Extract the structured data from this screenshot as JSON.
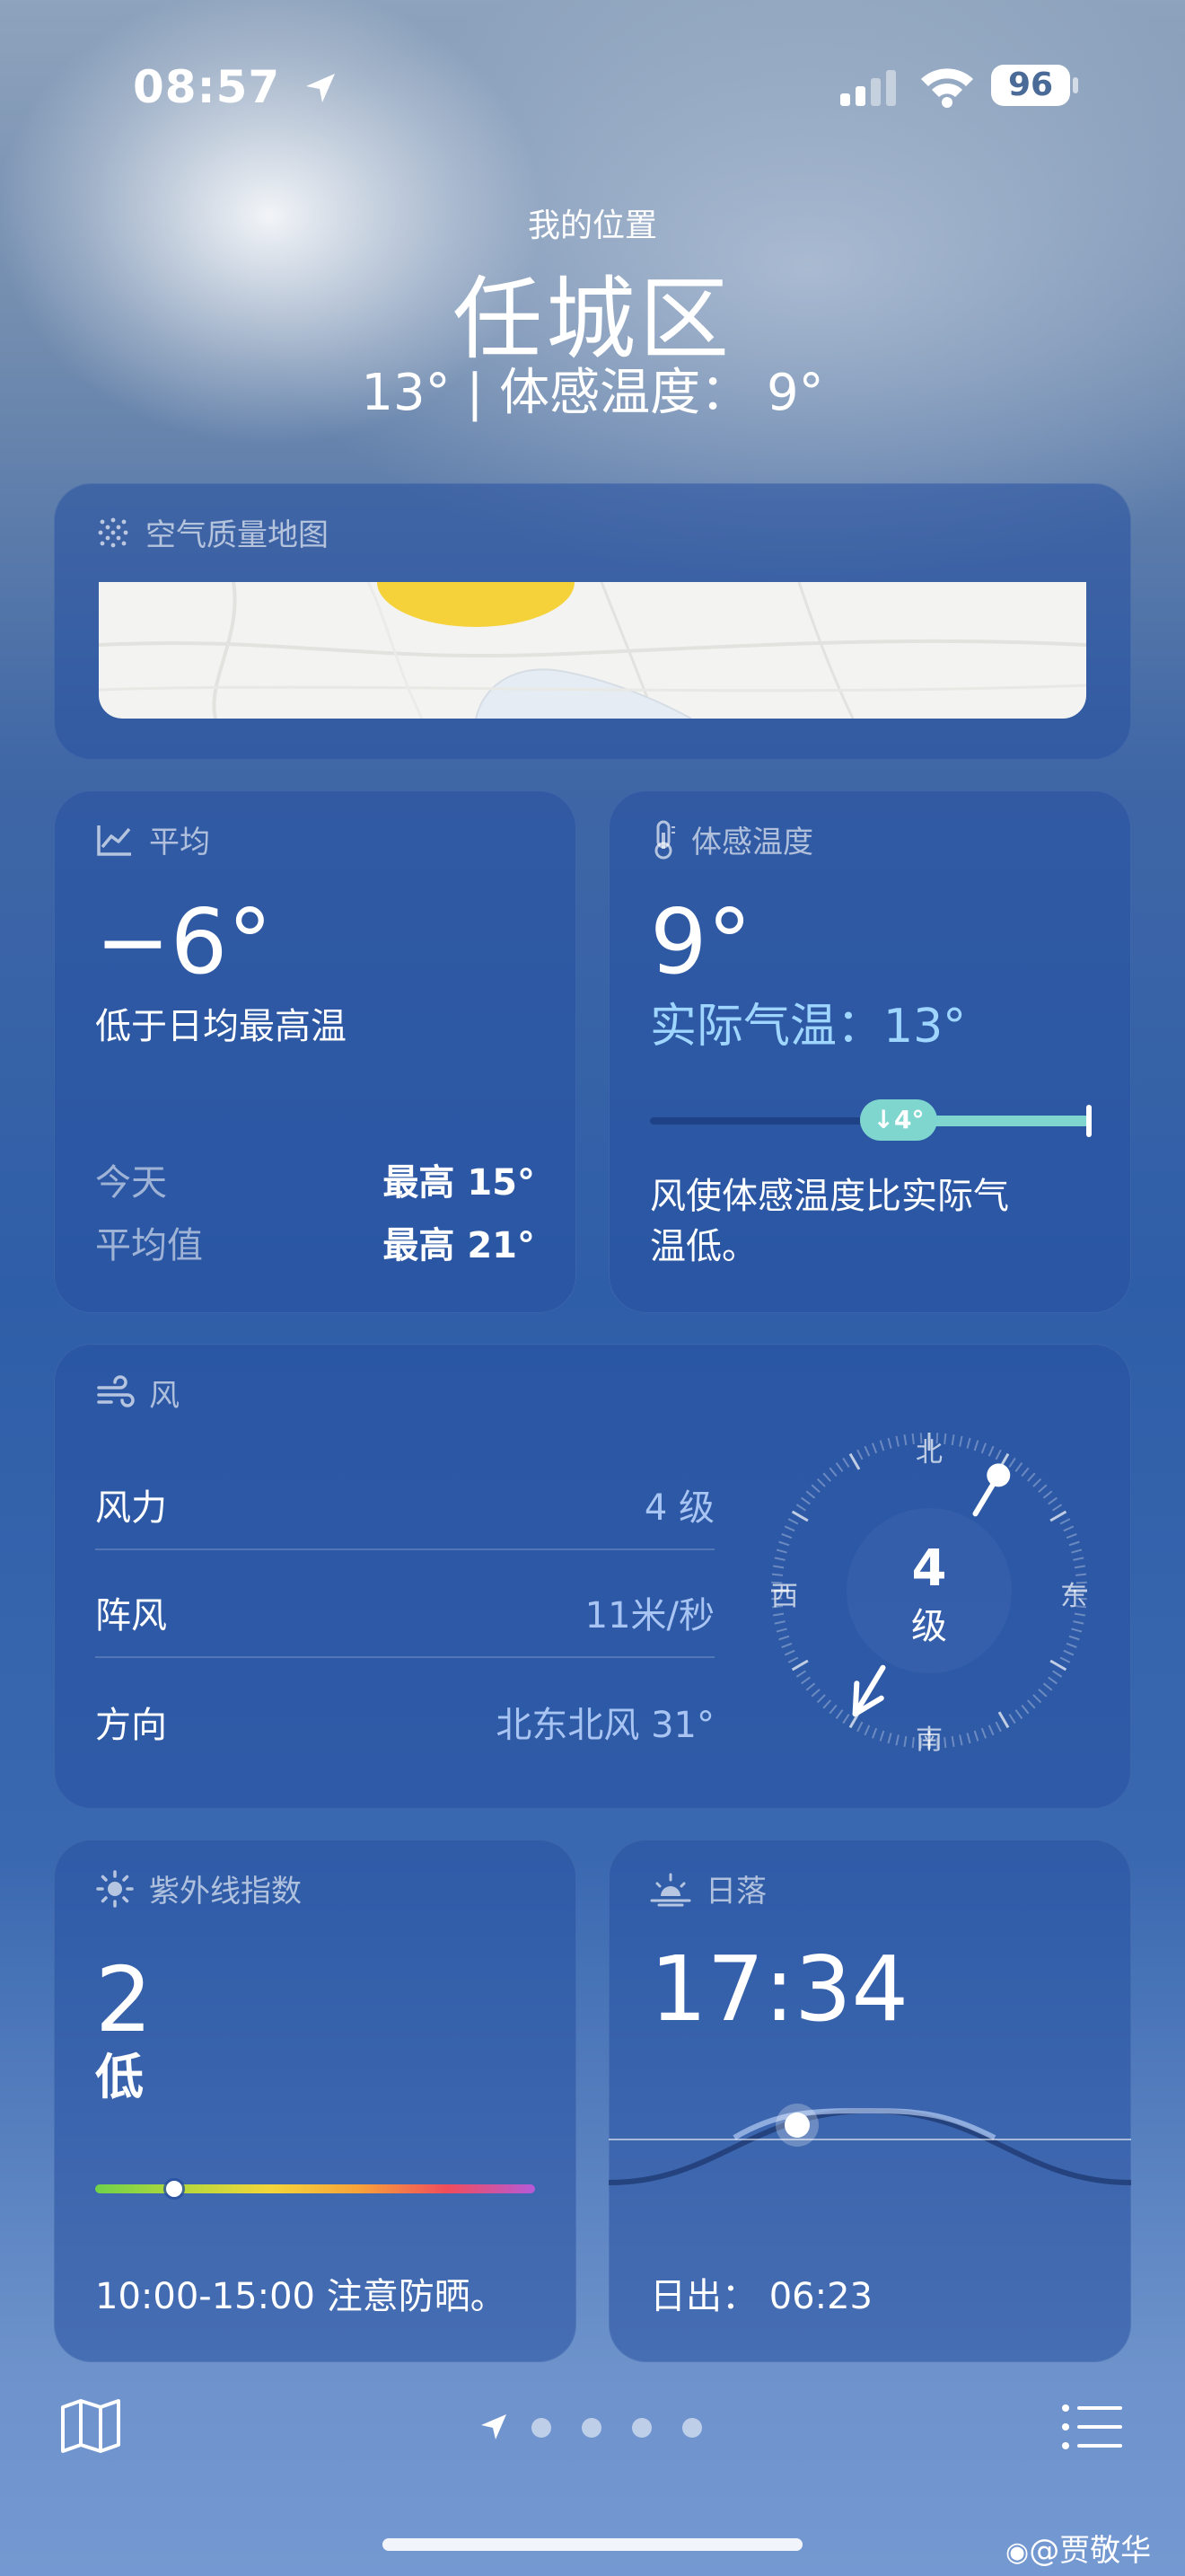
{
  "status_bar": {
    "time": "08:57",
    "battery": "96"
  },
  "header": {
    "location_label": "我的位置",
    "city": "任城区",
    "temp_line": "13° | 体感温度： 9°"
  },
  "air_quality": {
    "title": "空气质量地图"
  },
  "average": {
    "title": "平均",
    "value": "−6°",
    "description": "低于日均最高温",
    "today_label": "今天",
    "today_value": "最高 15°",
    "avg_label": "平均值",
    "avg_value": "最高 21°"
  },
  "feels_like": {
    "title": "体感温度",
    "value": "9°",
    "actual": "实际气温：13°",
    "delta_badge": "↓4°",
    "description": "风使体感温度比实际气温低。"
  },
  "wind": {
    "title": "风",
    "rows": [
      {
        "label": "风力",
        "value": "4 级"
      },
      {
        "label": "阵风",
        "value": "11米/秒"
      },
      {
        "label": "方向",
        "value": "北东北风 31°"
      }
    ],
    "compass": {
      "north": "北",
      "south": "南",
      "east": "东",
      "west": "西",
      "center_num": "4",
      "center_unit": "级",
      "direction_deg": 31
    }
  },
  "uv": {
    "title": "紫外线指数",
    "value": "2",
    "level": "低",
    "level_fraction": 0.18,
    "advice": "10:00-15:00 注意防晒。"
  },
  "sunset": {
    "title": "日落",
    "time": "17:34",
    "sunrise": "日出： 06:23"
  },
  "tabbar": {
    "page_count": 4
  },
  "watermark": "@贾敬华",
  "colors": {
    "accent_text": "#9fd6ff",
    "teal": "#7fd6cf"
  }
}
